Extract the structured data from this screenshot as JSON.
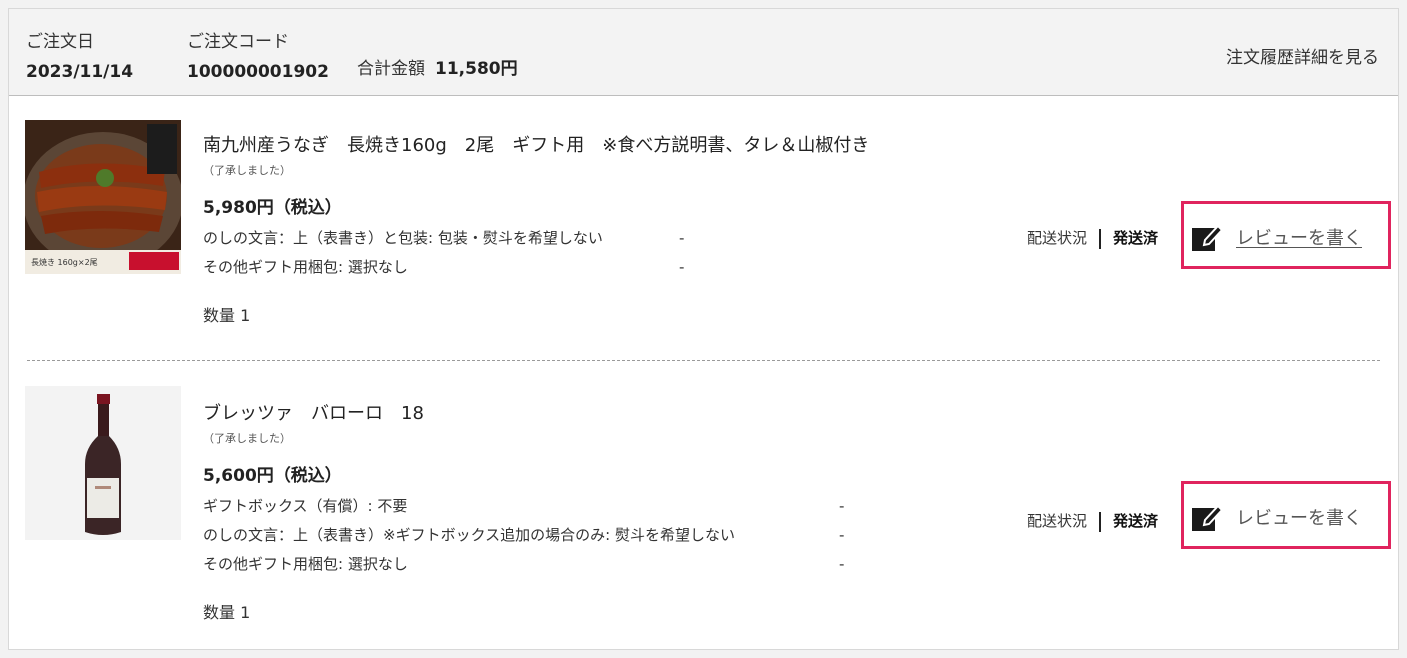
{
  "order": {
    "date_label": "ご注文日",
    "date_value": "2023/11/14",
    "code_label": "ご注文コード",
    "code_value": "100000001902",
    "total_label": "合計金額",
    "total_value": "11,580円",
    "detail_link": "注文履歴詳細を見る"
  },
  "items": [
    {
      "name": "南九州産うなぎ　長焼き160g　2尾　ギフト用　※食べ方説明書、タレ＆山椒付き",
      "note": "（了承しました）",
      "price": "5,980円（税込）",
      "options": [
        {
          "text": "のしの文言：上（表書き）と包装: 包装・熨斗を希望しない",
          "value": "-"
        },
        {
          "text": "その他ギフト用梱包: 選択なし",
          "value": "-"
        }
      ],
      "quantity": "数量 1",
      "status_label": "配送状況",
      "status_value": "発送済",
      "review_label": "レビューを書く",
      "thumb_text": [
        "長焼き 160g×2尾"
      ]
    },
    {
      "name": "ブレッツァ　バローロ　18",
      "note": "（了承しました）",
      "price": "5,600円（税込）",
      "options": [
        {
          "text": "ギフトボックス（有償）: 不要",
          "value": "-"
        },
        {
          "text": "のしの文言：上（表書き）※ギフトボックス追加の場合のみ: 熨斗を希望しない",
          "value": "-"
        },
        {
          "text": "その他ギフト用梱包: 選択なし",
          "value": "-"
        }
      ],
      "quantity": "数量 1",
      "status_label": "配送状況",
      "status_value": "発送済",
      "review_label": "レビューを書く"
    }
  ],
  "colors": {
    "highlight": "#e0245e",
    "header_bg": "#f3f3f3"
  },
  "icons": {
    "review": "edit-icon"
  }
}
